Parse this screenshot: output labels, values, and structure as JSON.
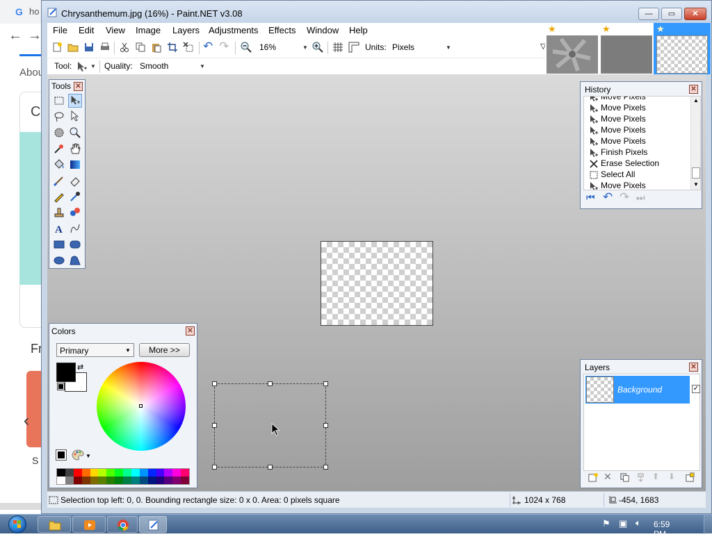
{
  "browser": {
    "tab_text": "ho",
    "about_text": "Abou",
    "fr_text": "Fr",
    "s_text": "S"
  },
  "window": {
    "title": "Chrysanthemum.jpg (16%) - Paint.NET v3.08",
    "minimize": "—",
    "maximize": "▭",
    "close": "✕"
  },
  "menu": [
    "File",
    "Edit",
    "View",
    "Image",
    "Layers",
    "Adjustments",
    "Effects",
    "Window",
    "Help"
  ],
  "toolbar": {
    "zoom_value": "16%",
    "units_label": "Units:",
    "units_value": "Pixels",
    "tool_label": "Tool:",
    "quality_label": "Quality:",
    "quality_value": "Smooth"
  },
  "panels": {
    "tools_title": "Tools",
    "history_title": "History",
    "colors_title": "Colors",
    "layers_title": "Layers"
  },
  "history": {
    "items": [
      {
        "label": "Move Pixels",
        "icon": "move-pixels-icon"
      },
      {
        "label": "Move Pixels",
        "icon": "move-pixels-icon"
      },
      {
        "label": "Move Pixels",
        "icon": "move-pixels-icon"
      },
      {
        "label": "Move Pixels",
        "icon": "move-pixels-icon"
      },
      {
        "label": "Move Pixels",
        "icon": "move-pixels-icon"
      },
      {
        "label": "Finish Pixels",
        "icon": "finish-pixels-icon"
      },
      {
        "label": "Erase Selection",
        "icon": "erase-selection-icon"
      },
      {
        "label": "Select All",
        "icon": "select-all-icon"
      },
      {
        "label": "Move Pixels",
        "icon": "move-pixels-icon"
      }
    ]
  },
  "colors": {
    "mode": "Primary",
    "more_button": "More >>",
    "primary": "#000000",
    "secondary": "#ffffff",
    "palette_top": [
      "#000000",
      "#404040",
      "#ff0000",
      "#ff6a00",
      "#ffd800",
      "#b6ff00",
      "#4cff00",
      "#00ff21",
      "#00ff90",
      "#00ffff",
      "#0094ff",
      "#0026ff",
      "#4800ff",
      "#b200ff",
      "#ff00dc",
      "#ff006e"
    ],
    "palette_bottom": [
      "#ffffff",
      "#808080",
      "#7f0000",
      "#7f3300",
      "#7f6a00",
      "#5b7f00",
      "#267f00",
      "#007f0e",
      "#007f46",
      "#007f7f",
      "#004a7f",
      "#00137f",
      "#21007f",
      "#57007f",
      "#7f006e",
      "#7f0037"
    ]
  },
  "layers": {
    "items": [
      {
        "name": "Background",
        "visible": true
      }
    ]
  },
  "status": {
    "selection_info": "Selection top left: 0, 0. Bounding rectangle size: 0 x 0. Area: 0 pixels square",
    "image_size": "1024 x 768",
    "cursor_position": "-454, 1683"
  },
  "taskbar": {
    "clock": "6:59 PM"
  },
  "accent": {
    "selection_blue": "#3399ff",
    "star": "#e8a800"
  }
}
